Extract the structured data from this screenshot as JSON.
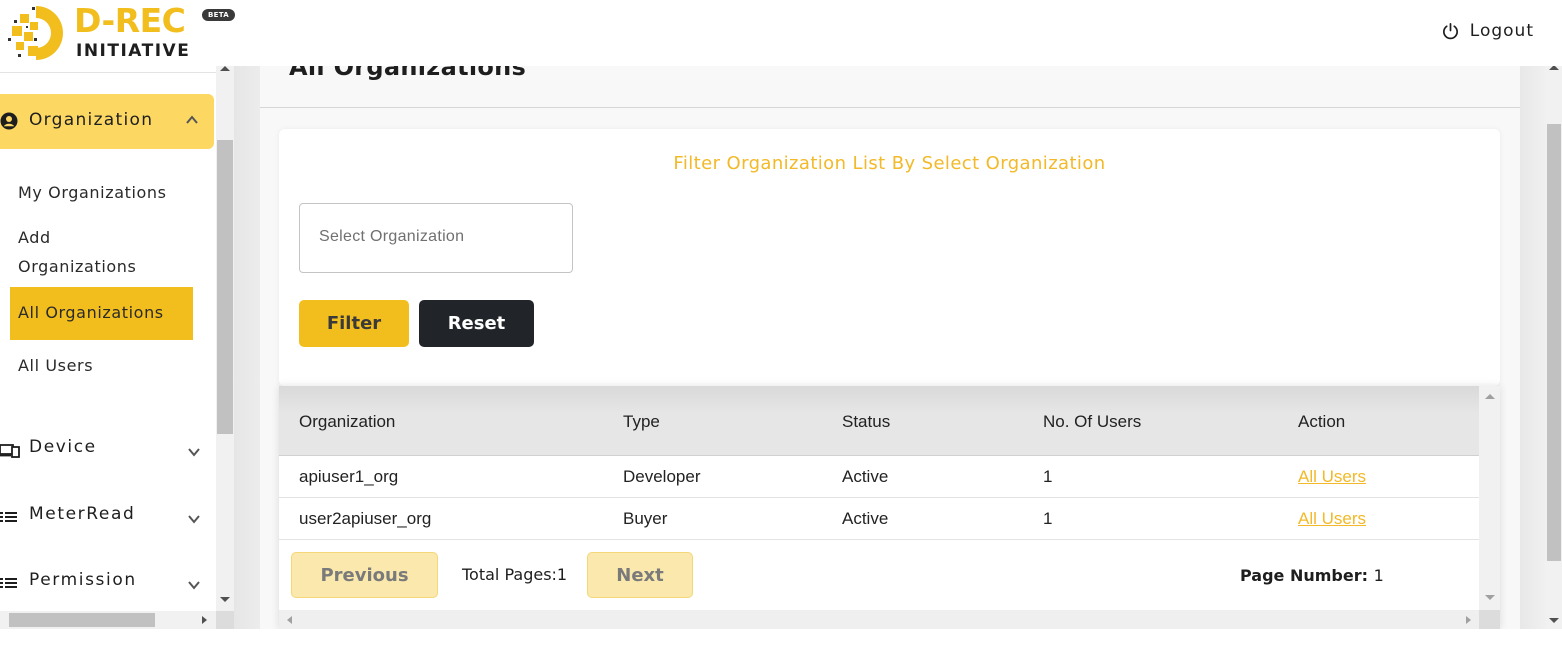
{
  "header": {
    "logo_title": "D-REC",
    "logo_subtitle": "INITIATIVE",
    "beta_badge": "BETA",
    "logout_label": "Logout",
    "brand_color": "#f2be1e"
  },
  "sidebar": {
    "active_group": {
      "label": "Organization",
      "icon": "user-circle-icon",
      "expanded": true,
      "items": [
        {
          "label": "My Organizations",
          "active": false
        },
        {
          "label": "Add Organizations",
          "active": false
        },
        {
          "label": "All Organizations",
          "active": true
        },
        {
          "label": "All Users",
          "active": false
        }
      ]
    },
    "groups": [
      {
        "label": "Device",
        "icon": "devices-icon",
        "expanded": false
      },
      {
        "label": "MeterRead",
        "icon": "list-icon",
        "expanded": false
      },
      {
        "label": "Permission",
        "icon": "list-icon",
        "expanded": false
      }
    ]
  },
  "main": {
    "page_title": "All Organizations",
    "filter": {
      "heading": "Filter Organization List By Select Organization",
      "select_placeholder": "Select Organization",
      "filter_label": "Filter",
      "reset_label": "Reset"
    },
    "table": {
      "columns": [
        "Organization",
        "Type",
        "Status",
        "No. Of Users",
        "Action"
      ],
      "rows": [
        {
          "organization": "apiuser1_org",
          "type": "Developer",
          "status": "Active",
          "users": "1",
          "action": "All Users"
        },
        {
          "organization": "user2apiuser_org",
          "type": "Buyer",
          "status": "Active",
          "users": "1",
          "action": "All Users"
        }
      ]
    },
    "pagination": {
      "previous_label": "Previous",
      "next_label": "Next",
      "total_pages": "Total Pages:1",
      "page_number_label": "Page Number:",
      "page_number": "1"
    }
  }
}
